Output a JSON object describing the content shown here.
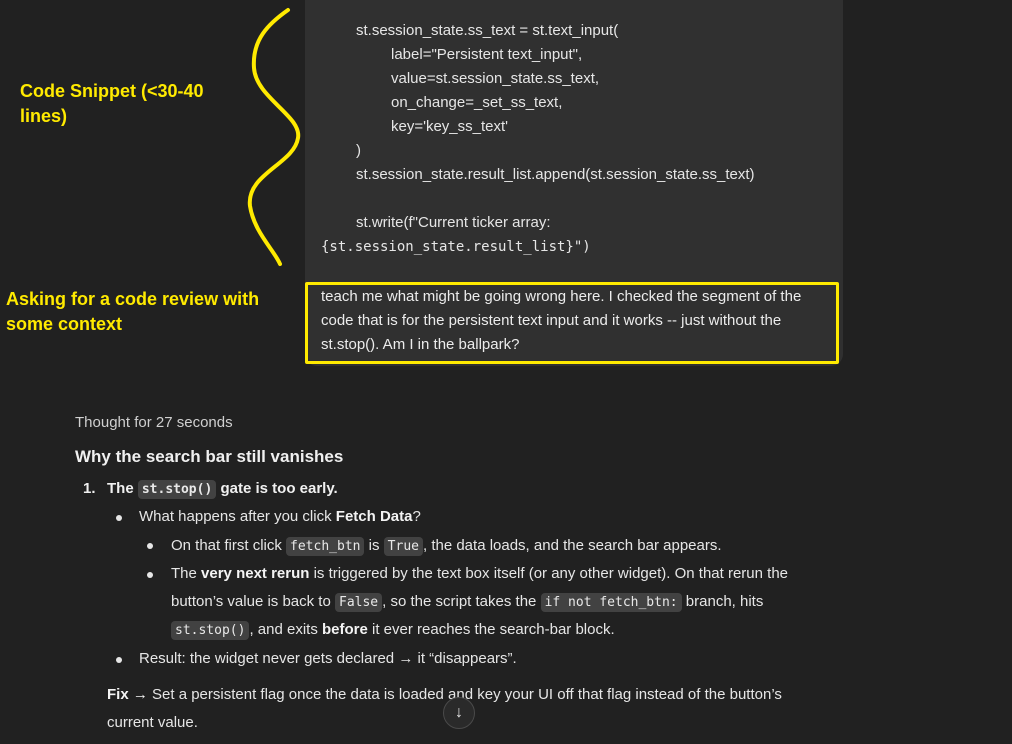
{
  "annotations": {
    "snippet": "Code Snippet (<30-40 lines)",
    "review": "Asking for a code review with some context"
  },
  "user_message": {
    "code": [
      "st.session_state.ss_text = st.text_input(",
      "label=\"Persistent text_input\",",
      "value=st.session_state.ss_text,",
      "on_change=_set_ss_text,",
      "key='key_ss_text'",
      ")",
      "st.session_state.result_list.append(st.session_state.ss_text)",
      "st.write(f\"Current ticker array:",
      "{st.session_state.result_list}\")"
    ],
    "text": "teach me what might be going wrong here. I checked the segment of the code that is for the persistent text input and it works -- just without the st.stop(). Am I in the ballpark?"
  },
  "response": {
    "thought": "Thought for 27 seconds",
    "heading": "Why the search bar still vanishes",
    "item1": {
      "number": "1.",
      "pre": "The",
      "code": "st.stop()",
      "post": "gate is too early."
    },
    "b1": {
      "pre": "What happens after you click",
      "bold": "Fetch Data",
      "post": "?"
    },
    "b2": {
      "pre": "On that first click",
      "code1": "fetch_btn",
      "mid": "is",
      "code2": "True",
      "post": ", the data loads, and the search bar appears."
    },
    "b3": {
      "pre": "The",
      "bold": "very next rerun",
      "post": "is triggered by the text box itself (or any other widget). On that rerun the",
      "l2pre": "button’s value is back to",
      "code1": "False",
      "l2mid": ", so the script takes the",
      "code2": "if not fetch_btn:",
      "l2post": "branch, hits",
      "code3": "st.stop()",
      "l3mid": ", and exits",
      "bold2": "before",
      "l3post": "it ever reaches the search-bar block."
    },
    "b4": {
      "text": "Result: the widget never gets declared → it “disappears”."
    },
    "fix": {
      "bold": "Fix →",
      "line1": "Set a persistent flag once the data is loaded and key your UI off that flag instead of the button’s",
      "line2": "current value."
    }
  }
}
